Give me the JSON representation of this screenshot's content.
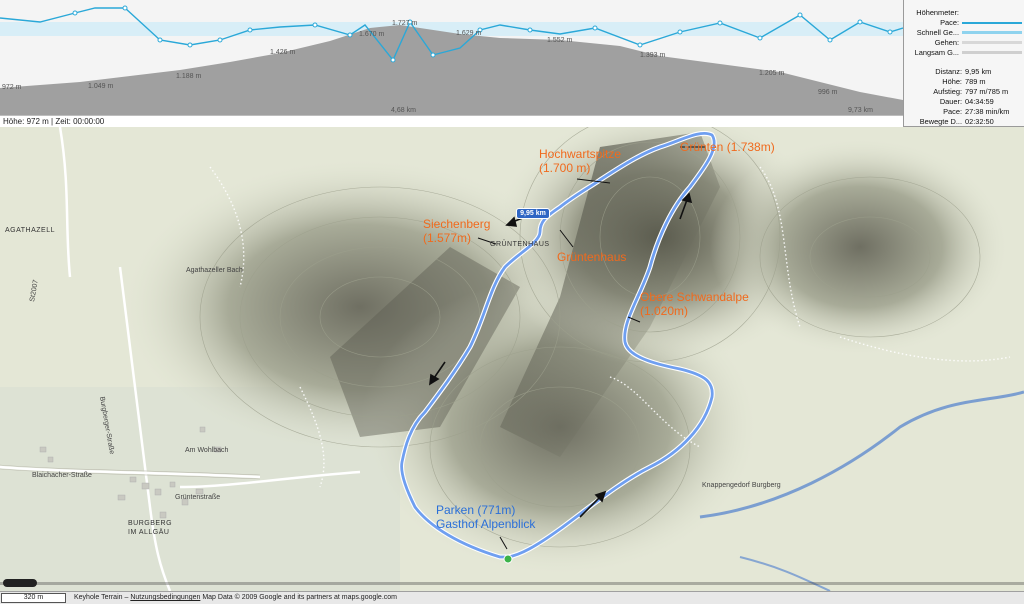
{
  "profile": {
    "elevation_labels": [
      "972 m",
      "1.049 m",
      "1.188 m",
      "1.426 m",
      "1.670 m",
      "1.727 m",
      "1.629 m",
      "1.552 m",
      "1.393 m",
      "1.205 m",
      "996 m"
    ],
    "distance_labels": [
      "4,68 km",
      "9,73 km"
    ],
    "status": "Höhe: 972 m | Zeit: 00:00:00",
    "colors": {
      "pace": "#2aa8d8",
      "elevation_fill": "#a0a0a0",
      "band": "#d8eef7"
    }
  },
  "legend": [
    {
      "label": "Höhenmeter:",
      "color": ""
    },
    {
      "label": "Pace:",
      "color": "#2aa8d8"
    },
    {
      "label": "Schnell Ge...",
      "color": "#8fd3ee"
    },
    {
      "label": "Gehen:",
      "color": "#d8d8d8"
    },
    {
      "label": "Langsam G...",
      "color": "#cfcfcf"
    }
  ],
  "stats": [
    {
      "key": "Distanz:",
      "value": "9,95 km"
    },
    {
      "key": "Höhe:",
      "value": "789 m"
    },
    {
      "key": "Aufstieg:",
      "value": "797 m/785 m"
    },
    {
      "key": "Dauer:",
      "value": "04:34:59"
    },
    {
      "key": "Pace:",
      "value": "27:38 min/km"
    },
    {
      "key": "Bewegte D...",
      "value": "02:32:50"
    }
  ],
  "map": {
    "places": [
      "AGATHAZELL",
      "BURGBERG",
      "IM ALLGÄU",
      "GRÜNTENHAUS"
    ],
    "roads": [
      "St2007",
      "Burgberger-Straße",
      "Blaichacher-Straße",
      "Grüntenstraße",
      "Am Wohlbach",
      "Agathazeller Bach",
      "Knappengedorf Burgberg"
    ],
    "annotations": {
      "hochwartspitze": [
        "Hochwartspitze",
        "(1.700 m)"
      ],
      "gruenten": "Grünten (1.738m)",
      "siechenberg": [
        "Siechenberg",
        "(1.577m)"
      ],
      "gruentenhaus": "Grüntenhaus",
      "obere_schwandalpe": [
        "Obere Schwandalpe",
        "(1.020m)"
      ],
      "parken": [
        "Parken (771m)",
        "Gasthof Alpenblick"
      ]
    },
    "distance_badge": "9,95 km",
    "colors": {
      "route": "#6f9ff0",
      "route_outline": "#ffffff",
      "annotation_orange": "#f06a1d",
      "annotation_blue": "#2a6fd8",
      "terrain": "#e4e7d6"
    }
  },
  "footer": {
    "scale": "320 m",
    "attribution_prefix": "Keyhole Terrain –",
    "terms_link": "Nutzungsbedingungen",
    "attribution_suffix": "Map Data © 2009 Google and its partners at maps.google.com"
  }
}
